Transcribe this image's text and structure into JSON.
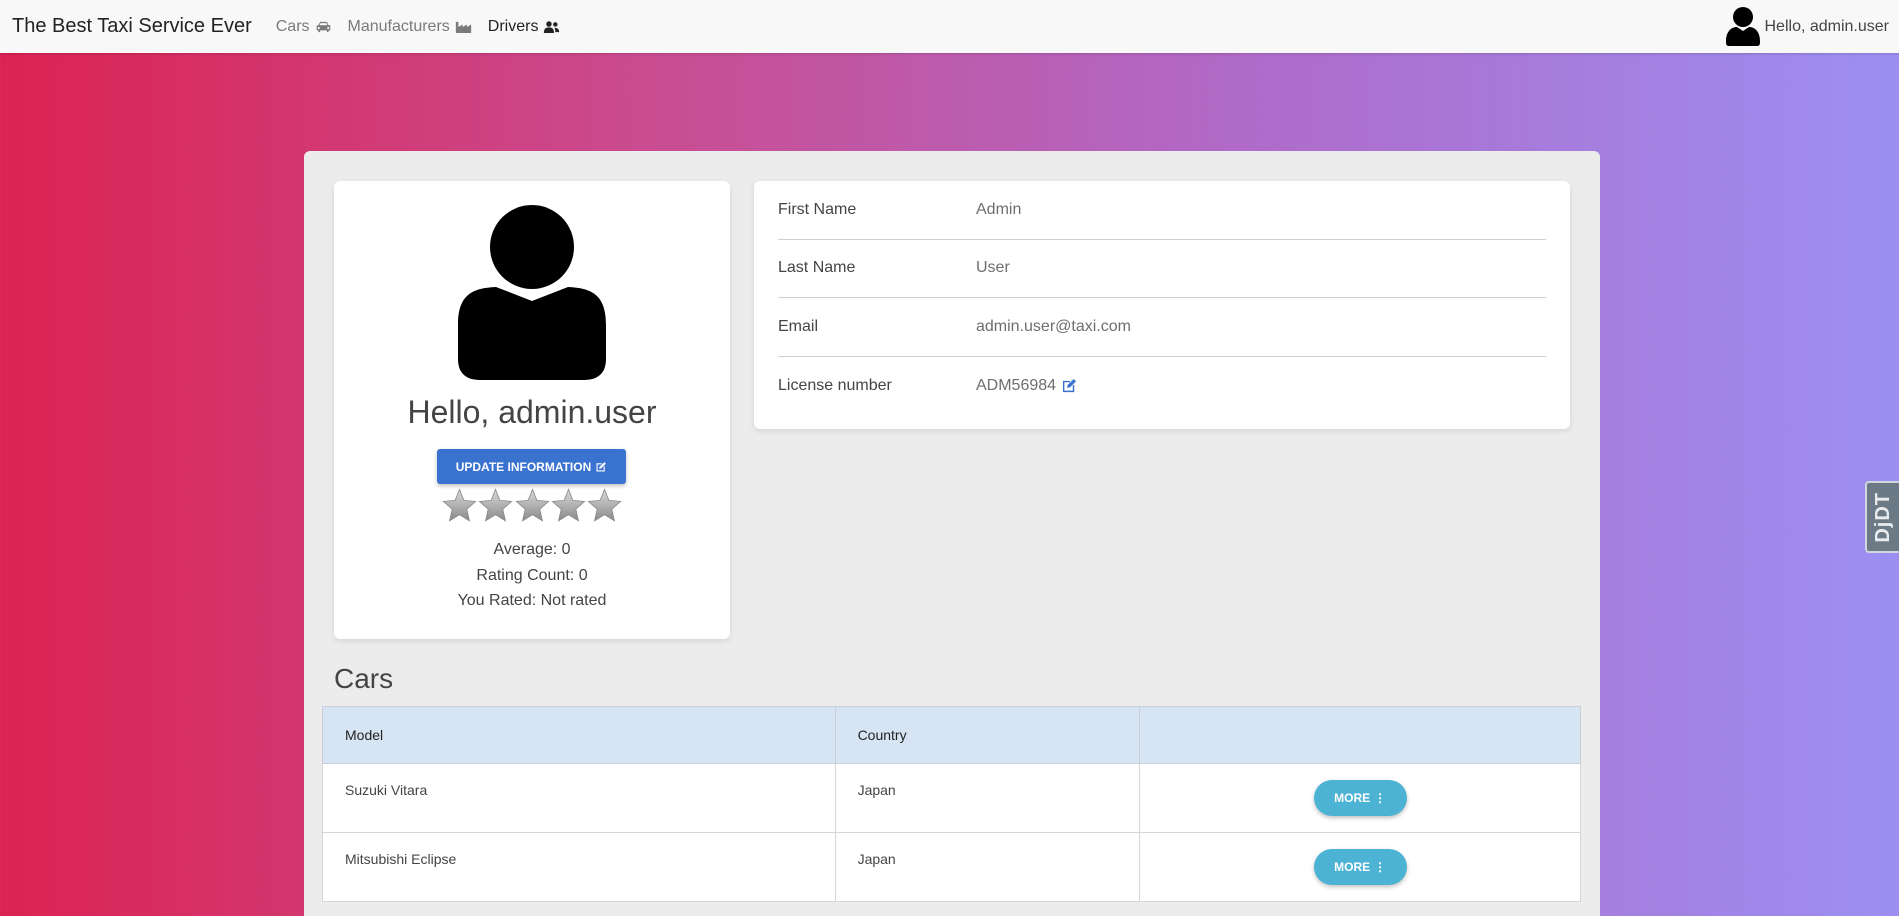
{
  "navbar": {
    "brand": "The Best Taxi Service Ever",
    "links": [
      {
        "label": "Cars",
        "icon": "car-icon"
      },
      {
        "label": "Manufacturers",
        "icon": "industry-icon"
      },
      {
        "label": "Drivers",
        "icon": "users-icon",
        "active": true
      }
    ],
    "user_greeting": "Hello, admin.user"
  },
  "profile": {
    "greeting": "Hello, admin.user",
    "update_button": "UPDATE INFORMATION",
    "rating": {
      "stars_filled": 0,
      "stars_total": 5,
      "average": "Average: 0",
      "count": "Rating Count: 0",
      "you_rated": "You Rated: Not rated"
    }
  },
  "info": [
    {
      "label": "First Name",
      "value": "Admin"
    },
    {
      "label": "Last Name",
      "value": "User"
    },
    {
      "label": "Email",
      "value": "admin.user@taxi.com"
    },
    {
      "label": "License number",
      "value": "ADM56984",
      "editable": true
    }
  ],
  "cars": {
    "heading": "Cars",
    "columns": [
      "Model",
      "Country",
      ""
    ],
    "rows": [
      {
        "model": "Suzuki Vitara",
        "country": "Japan",
        "action": "MORE"
      },
      {
        "model": "Mitsubishi Eclipse",
        "country": "Japan",
        "action": "MORE"
      }
    ]
  },
  "debug_toolbar": "DjDT",
  "colors": {
    "primary_button": "#3a72d0",
    "more_button": "#4cb3d4",
    "table_header": "#d6e4f3",
    "gradient_start": "#dc2352",
    "gradient_end": "#9c8ff2"
  }
}
